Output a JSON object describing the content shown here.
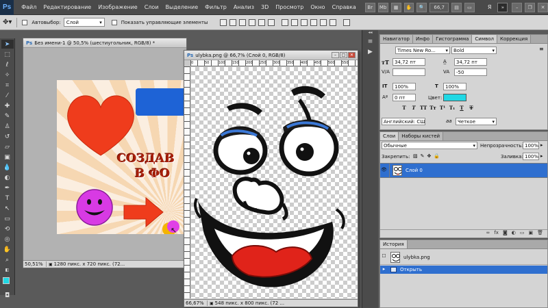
{
  "app": {
    "logo": "Ps"
  },
  "menubar": {
    "items": [
      "Файл",
      "Редактирование",
      "Изображение",
      "Слои",
      "Выделение",
      "Фильтр",
      "Анализ",
      "3D",
      "Просмотр",
      "Окно",
      "Справка"
    ],
    "icons": [
      "Br",
      "Mb"
    ],
    "zoom": "66,7",
    "workspace": "Я"
  },
  "options": {
    "autoselect_label": "Автовыбор:",
    "autoselect_value": "Слой",
    "show_controls_label": "Показать управляющие элементы"
  },
  "doc1": {
    "title": "Без имени-1 @ 50,5% (шестиугольник, RGB/8) *",
    "zoom": "50,51%",
    "info": "1280 пикс. x 720 пикс. (72..."
  },
  "doc2": {
    "title": "ulybka.png @ 66,7% (Слой 0, RGB/8)",
    "zoom": "66,67%",
    "info": "548 пикс. x 800 пикс. (72 ...",
    "ruler_numbers": [
      "0",
      "50",
      "100",
      "150",
      "200",
      "250",
      "300",
      "350",
      "400",
      "450",
      "500",
      "550"
    ]
  },
  "banner": {
    "line1": "СОЗДАВ",
    "line2": "В ФО"
  },
  "char_panel": {
    "tabs": [
      "Навигатор",
      "Инфо",
      "Гистограмма",
      "Символ",
      "Коррекция"
    ],
    "active_tab": "Символ",
    "font_family": "Times New Ro...",
    "font_style": "Bold",
    "size": "34,72 пт",
    "leading": "34,72 пт",
    "kerning": "",
    "tracking": "-50",
    "vscale": "100%",
    "hscale": "100%",
    "baseline": "0 пт",
    "color_label": "Цвет:",
    "color": "#20d8e4",
    "type_buttons": [
      "T",
      "T",
      "TT",
      "Tт",
      "T¹",
      "T₁",
      "T",
      "T"
    ],
    "language": "Английский: США",
    "aa_icon": "aa",
    "antialias": "Четкое"
  },
  "layers_panel": {
    "tabs": [
      "Слои",
      "Наборы кистей"
    ],
    "blend_mode": "Обычные",
    "opacity_label": "Непрозрачность:",
    "opacity": "100%",
    "lock_label": "Закрепить:",
    "fill_label": "Заливка:",
    "fill": "100%",
    "layers": [
      "Слой 0"
    ]
  },
  "history_panel": {
    "tab": "История",
    "snapshot": "ulybka.png",
    "steps": [
      "Открыть"
    ]
  }
}
